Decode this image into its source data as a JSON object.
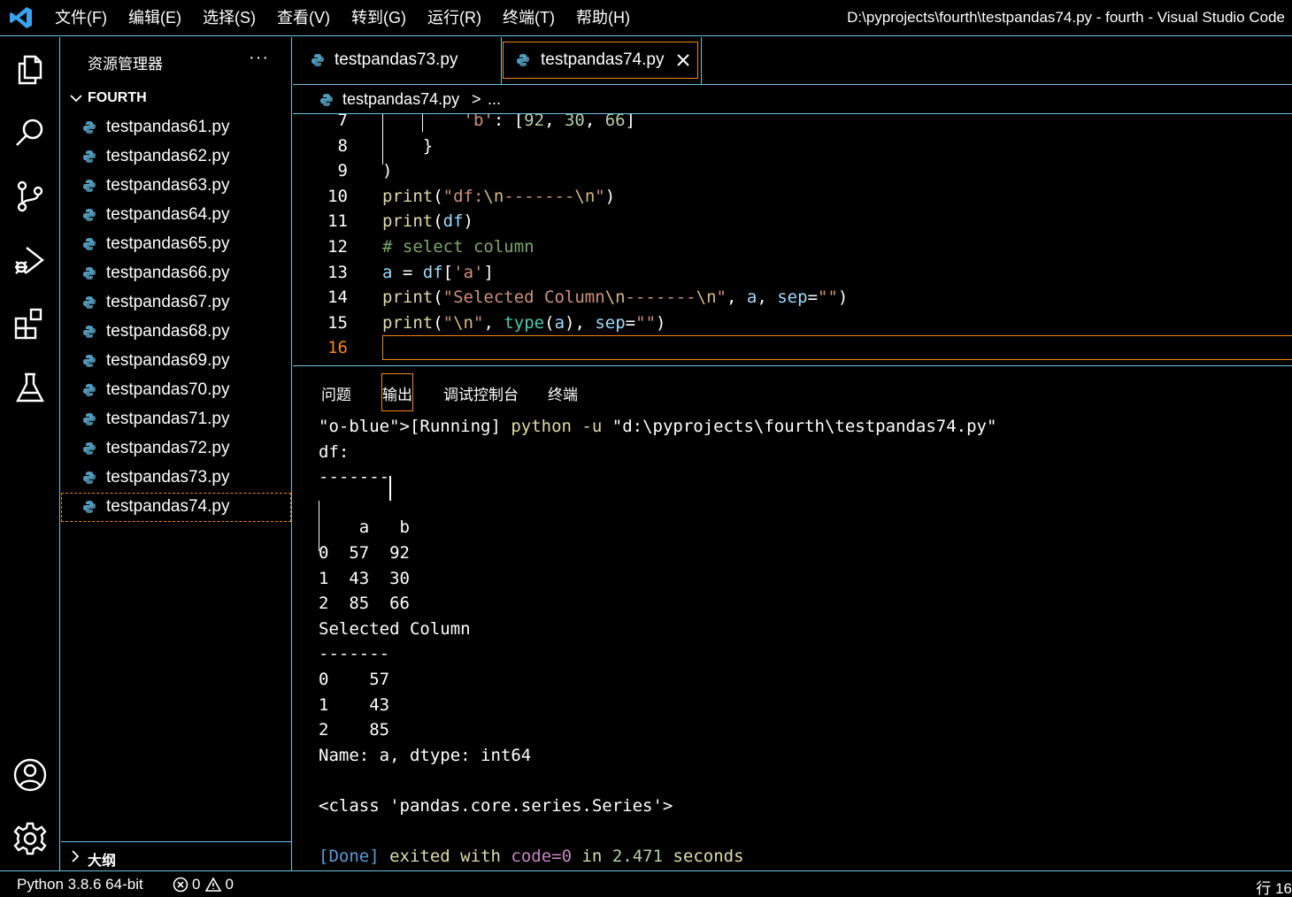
{
  "window": {
    "title": "D:\\pyprojects\\fourth\\testpandas74.py - fourth - Visual Studio Code"
  },
  "menu": [
    "文件(F)",
    "编辑(E)",
    "选择(S)",
    "查看(V)",
    "转到(G)",
    "运行(R)",
    "终端(T)",
    "帮助(H)"
  ],
  "activity_bar": {
    "icons": [
      "explorer-icon",
      "search-icon",
      "source-control-icon",
      "run-debug-icon",
      "extensions-icon",
      "testing-icon",
      "account-icon",
      "settings-gear-icon"
    ]
  },
  "sidebar": {
    "title": "资源管理器",
    "more": "···",
    "folder": "FOURTH",
    "files": [
      "testpandas61.py",
      "testpandas62.py",
      "testpandas63.py",
      "testpandas64.py",
      "testpandas65.py",
      "testpandas66.py",
      "testpandas67.py",
      "testpandas68.py",
      "testpandas69.py",
      "testpandas70.py",
      "testpandas71.py",
      "testpandas72.py",
      "testpandas73.py",
      "testpandas74.py"
    ],
    "selected_file": "testpandas74.py",
    "outline_label": "大纲"
  },
  "tabs": [
    {
      "label": "testpandas73.py",
      "active": false
    },
    {
      "label": "testpandas74.py",
      "active": true
    }
  ],
  "breadcrumb": {
    "file": "testpandas74.py",
    "separator": ">",
    "more": "..."
  },
  "editor": {
    "current_line": 16,
    "lines": [
      {
        "no": "7",
        "code": "        'b': [92, 30, 66]"
      },
      {
        "no": "8",
        "code": "    }"
      },
      {
        "no": "9",
        "code": ")"
      },
      {
        "no": "10",
        "code": "print(\"df:\\n-------\\n\")"
      },
      {
        "no": "11",
        "code": "print(df)"
      },
      {
        "no": "12",
        "code": "# select column"
      },
      {
        "no": "13",
        "code": "a = df['a']"
      },
      {
        "no": "14",
        "code": "print(\"Selected Column\\n-------\\n\", a, sep=\"\")"
      },
      {
        "no": "15",
        "code": "print(\"\\n\", type(a), sep=\"\")"
      },
      {
        "no": "16",
        "code": ""
      }
    ]
  },
  "panel": {
    "tabs": [
      "问题",
      "输出",
      "调试控制台",
      "终端"
    ],
    "active_tab": "输出",
    "output": [
      "[Running] python -u \"d:\\pyprojects\\fourth\\testpandas74.py\"",
      "df:",
      "-------",
      "",
      "    a   b",
      "0  57  92",
      "1  43  30",
      "2  85  66",
      "Selected Column",
      "-------",
      "0    57",
      "1    43",
      "2    85",
      "Name: a, dtype: int64",
      "",
      "<class 'pandas.core.series.Series'>",
      "",
      "[Done] exited with code=0 in 2.471 seconds"
    ]
  },
  "statusbar": {
    "python": "Python 3.8.6 64-bit",
    "errors": "0",
    "warnings": "0",
    "line_info": "行 16"
  },
  "colors": {
    "border": "#6fc3df",
    "focus": "#f38518",
    "background": "#000000"
  }
}
